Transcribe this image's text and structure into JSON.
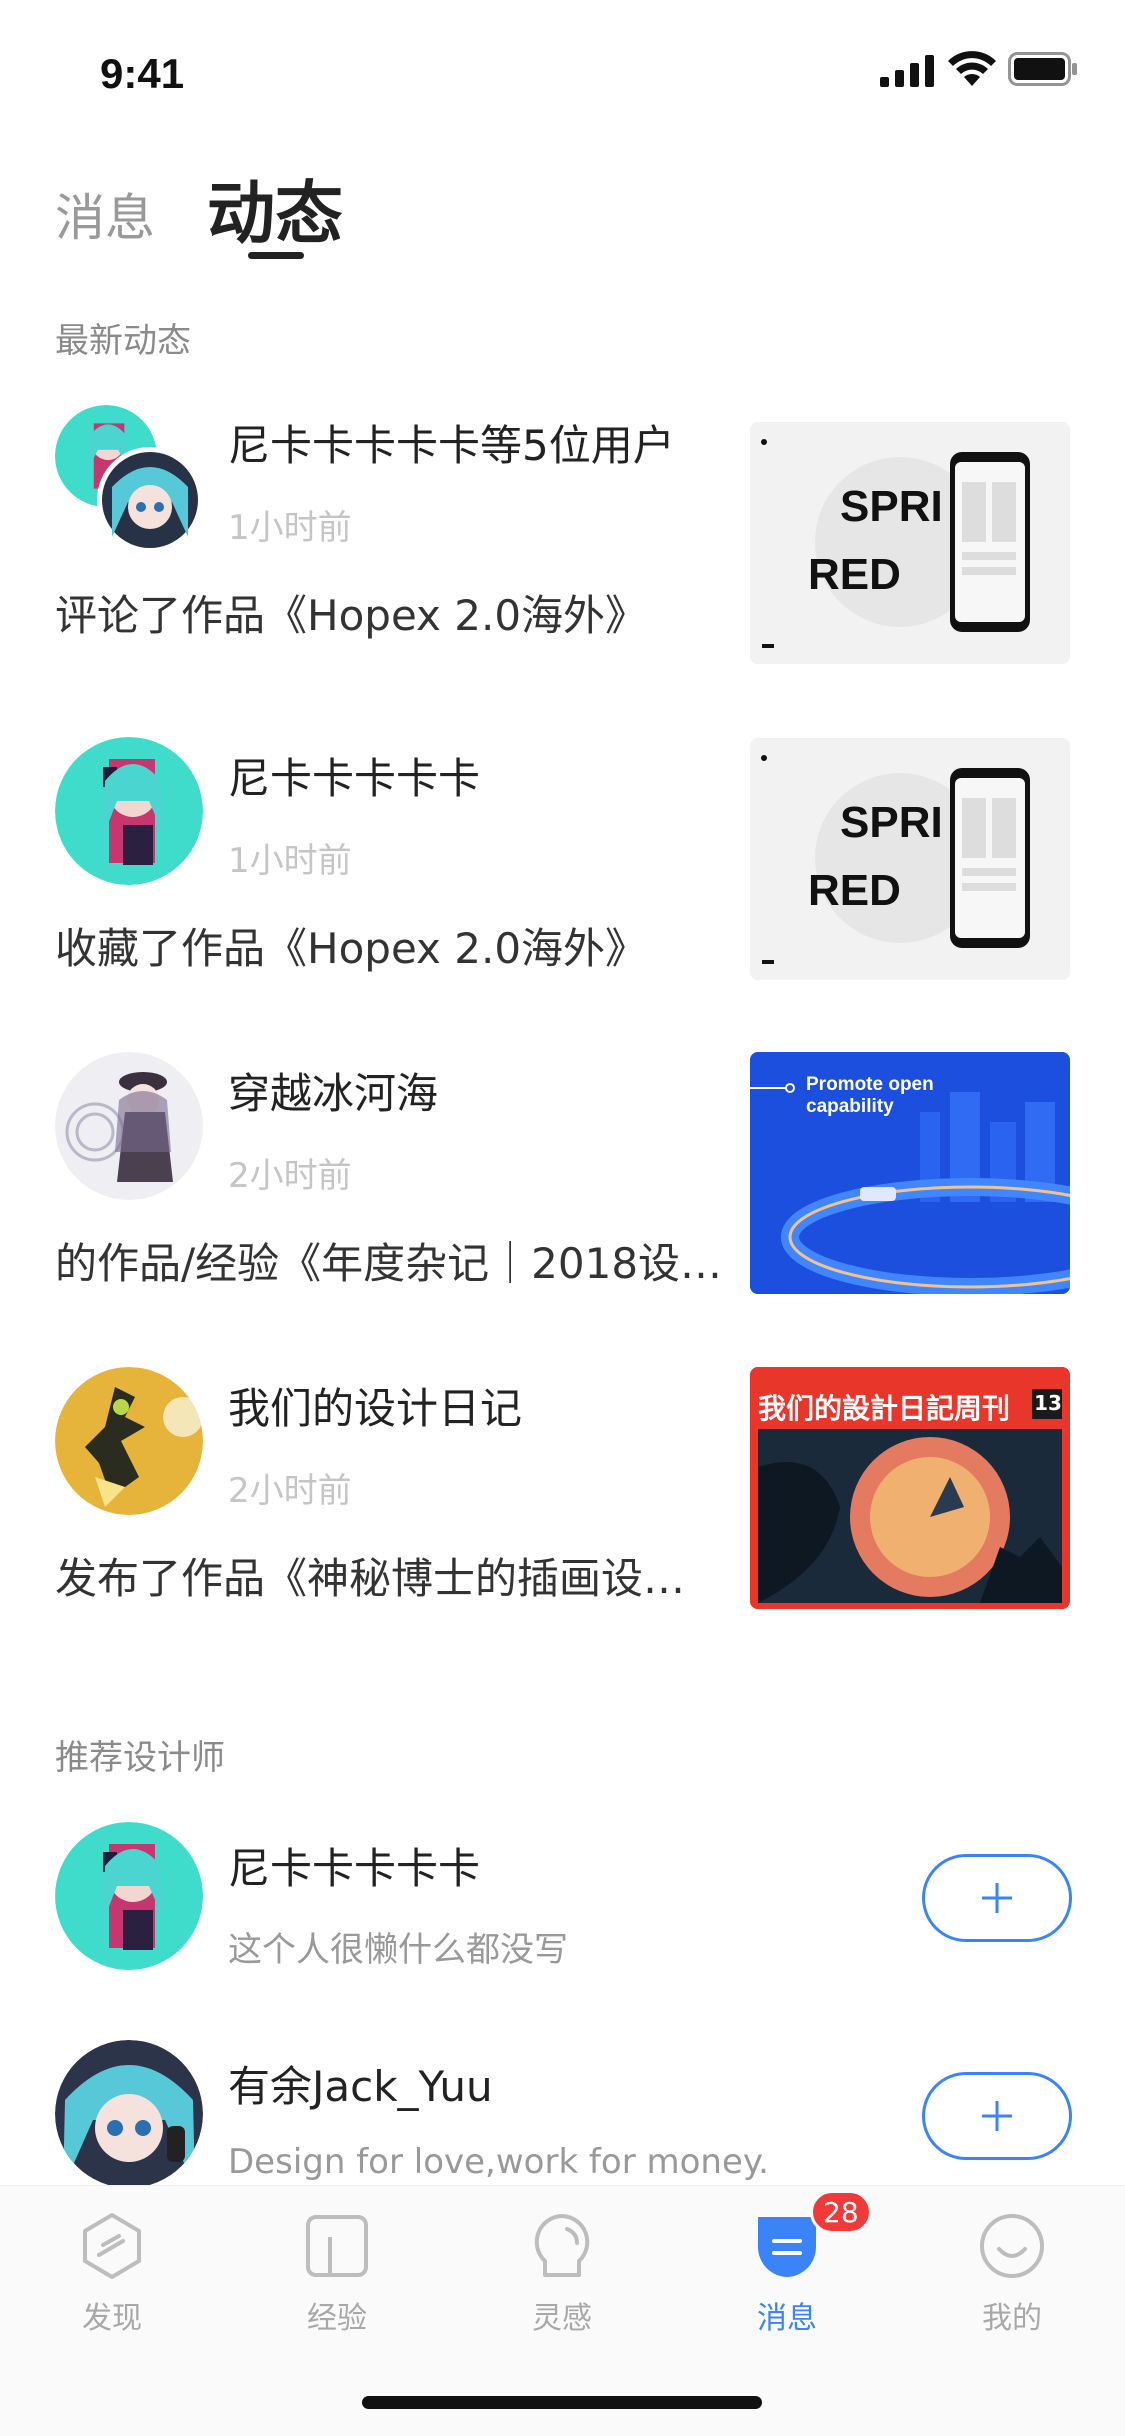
{
  "status_bar": {
    "time": "9:41"
  },
  "tabs": {
    "messages": "消息",
    "activity": "动态"
  },
  "latest": {
    "title": "最新动态",
    "items": [
      {
        "name": "尼卡卡卡卡卡等5位用户",
        "time": "1小时前",
        "action": "评论了作品《Hopex 2.0海外》",
        "thumb": "spring"
      },
      {
        "name": "尼卡卡卡卡卡",
        "time": "1小时前",
        "action": "收藏了作品《Hopex 2.0海外》",
        "thumb": "spring"
      },
      {
        "name": "穿越冰河海",
        "time": "2小时前",
        "action": "的作品/经验《年度杂记｜2018设…",
        "thumb": "blue"
      },
      {
        "name": "我们的设计日记",
        "time": "2小时前",
        "action": "发布了作品《神秘博士的插画设…",
        "thumb": "red"
      }
    ],
    "thumb_spring_text": [
      "SPRI",
      "RED"
    ],
    "thumb_blue_text": [
      "Promote open",
      "capability"
    ],
    "thumb_red_text": "我们的設計日記周刊",
    "thumb_red_number": "13"
  },
  "recommend": {
    "title": "推荐设计师",
    "items": [
      {
        "name": "尼卡卡卡卡卡",
        "bio": "这个人很懒什么都没写",
        "button": "+"
      },
      {
        "name": "有余Jack_Yuu",
        "bio": "Design for love,work for money.",
        "button": "+"
      }
    ]
  },
  "tabbar": {
    "items": [
      {
        "label": "发现",
        "icon": "discover-icon"
      },
      {
        "label": "经验",
        "icon": "experience-icon"
      },
      {
        "label": "灵感",
        "icon": "inspiration-icon"
      },
      {
        "label": "消息",
        "icon": "message-icon",
        "active": true
      },
      {
        "label": "我的",
        "icon": "profile-icon"
      }
    ],
    "badge": "28"
  },
  "colors": {
    "accent": "#3a84f7",
    "badge": "#f03a3a",
    "teal": "#3fdccb"
  }
}
